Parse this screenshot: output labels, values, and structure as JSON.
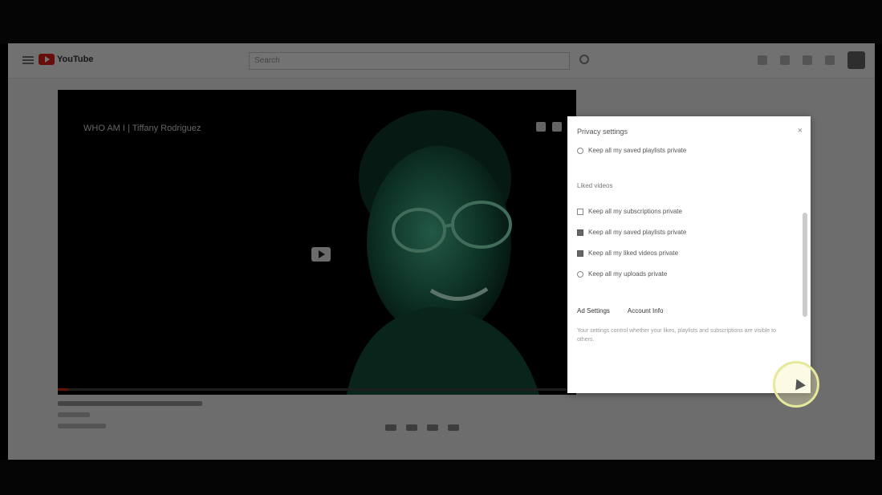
{
  "app": {
    "wordmark": "YouTube",
    "search_placeholder": "Search"
  },
  "video": {
    "title": "WHO AM I | Tiffany Rodriguez",
    "progress": 0.02
  },
  "panel": {
    "title": "Privacy settings",
    "close_glyph": "×",
    "first_option": "Keep all my saved playlists private",
    "section_label": "Liked videos",
    "options": [
      {
        "label": "Keep all my subscriptions private",
        "checked": false
      },
      {
        "label": "Keep all my saved playlists private",
        "checked": true
      },
      {
        "label": "Keep all my liked videos private",
        "checked": true
      },
      {
        "label": "Keep all my uploads private",
        "checked": false
      }
    ],
    "link_left": "Ad Settings",
    "link_right": "Account Info",
    "note": "Your settings control whether your likes, playlists and subscriptions are visible to others."
  },
  "colors": {
    "accent": "#e62117",
    "face_tint": "#3fae8a",
    "cursor_ring": "#e6e89a"
  },
  "icons": [
    "menu-icon",
    "youtube-logo",
    "search-icon",
    "play-icon",
    "close-icon",
    "cursor-icon"
  ]
}
